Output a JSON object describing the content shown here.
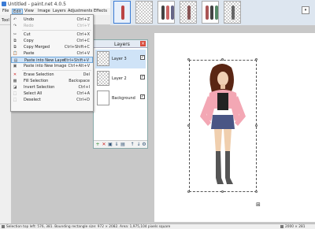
{
  "window": {
    "title": "Untitled - paint.net 4.0.5"
  },
  "menubar": [
    "File",
    "Edit",
    "View",
    "Image",
    "Layers",
    "Adjustments",
    "Effects"
  ],
  "toolbar": {
    "tools_label": "Tool"
  },
  "edit_menu": [
    {
      "label": "Undo",
      "shortcut": "Ctrl+Z",
      "icon": "undo-icon",
      "enabled": true
    },
    {
      "label": "Redo",
      "shortcut": "Ctrl+Y",
      "icon": "redo-icon",
      "enabled": false
    },
    {
      "label": "Cut",
      "shortcut": "Ctrl+X",
      "icon": "cut-icon",
      "enabled": true
    },
    {
      "label": "Copy",
      "shortcut": "Ctrl+C",
      "icon": "copy-icon",
      "enabled": true
    },
    {
      "label": "Copy Merged",
      "shortcut": "Ctrl+Shift+C",
      "icon": "copy-merged-icon",
      "enabled": true
    },
    {
      "label": "Paste",
      "shortcut": "Ctrl+V",
      "icon": "paste-icon",
      "enabled": true
    },
    {
      "label": "Paste into New Layer",
      "shortcut": "Ctrl+Shift+V",
      "icon": "paste-new-layer-icon",
      "enabled": true,
      "highlighted": true
    },
    {
      "label": "Paste into New Image",
      "shortcut": "Ctrl+Alt+V",
      "icon": "paste-new-image-icon",
      "enabled": true
    },
    {
      "label": "Erase Selection",
      "shortcut": "Del",
      "icon": "erase-selection-icon",
      "enabled": true
    },
    {
      "label": "Fill Selection",
      "shortcut": "Backspace",
      "icon": "fill-selection-icon",
      "enabled": true
    },
    {
      "label": "Invert Selection",
      "shortcut": "Ctrl+I",
      "icon": "invert-selection-icon",
      "enabled": true
    },
    {
      "label": "Select All",
      "shortcut": "Ctrl+A",
      "icon": "select-all-icon",
      "enabled": true
    },
    {
      "label": "Deselect",
      "shortcut": "Ctrl+D",
      "icon": "deselect-icon",
      "enabled": true
    }
  ],
  "layers_panel": {
    "title": "Layers",
    "close": "×",
    "layers": [
      {
        "name": "Layer 3",
        "visible": true,
        "selected": true
      },
      {
        "name": "Layer 2",
        "visible": true,
        "selected": false
      },
      {
        "name": "Background",
        "visible": true,
        "selected": false
      }
    ]
  },
  "statusbar": {
    "text": "Selection top left: 576, 381. Bounding rectangle size: 972 × 2082. Area: 1,975,104 pixels square",
    "zoom": "2000 × 281"
  },
  "colors": {
    "accent": "#3a7bd5",
    "menu_highlight": "#cfe3f7",
    "close_button": "#d84a3a"
  }
}
